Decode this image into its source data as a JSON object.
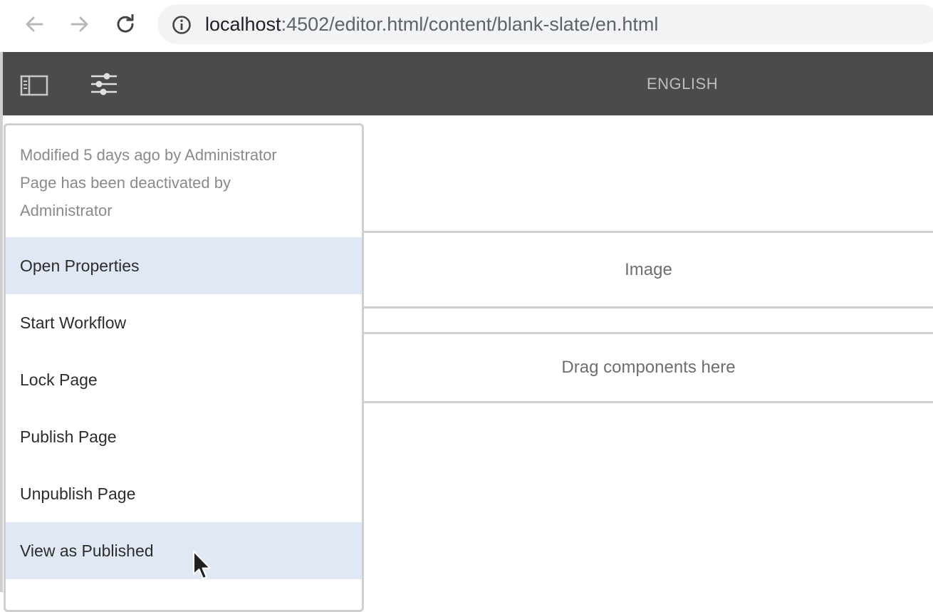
{
  "browser": {
    "url_host": "localhost",
    "url_rest": ":4502/editor.html/content/blank-slate/en.html",
    "icons": [
      "back-arrow-icon",
      "forward-arrow-icon",
      "reload-icon",
      "info-icon"
    ]
  },
  "toolbar": {
    "page_title": "ENGLISH",
    "icons": [
      "side-panel-icon",
      "page-information-icon"
    ],
    "background": "#4b4b4b"
  },
  "canvas": {
    "image_placeholder": "Image",
    "drop_placeholder": "Drag components here"
  },
  "page_info_popover": {
    "meta_lines": [
      "Modified 5 days ago by Administrator",
      "Page has been deactivated by",
      "Administrator"
    ],
    "menu_items": [
      {
        "label": "Open Properties",
        "highlighted": true
      },
      {
        "label": "Start Workflow",
        "highlighted": false
      },
      {
        "label": "Lock Page",
        "highlighted": false
      },
      {
        "label": "Publish Page",
        "highlighted": false
      },
      {
        "label": "Unpublish Page",
        "highlighted": false
      },
      {
        "label": "View as Published",
        "highlighted": true
      }
    ],
    "highlight_color": "#e1e8f5"
  }
}
